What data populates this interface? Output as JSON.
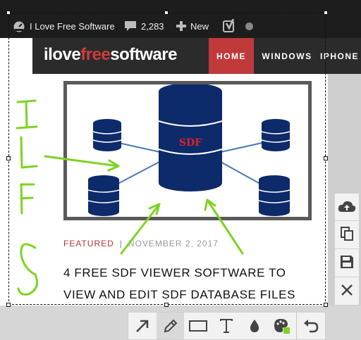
{
  "admin_bar": {
    "site_name": "I Love Free Software",
    "comments_count": "2,283",
    "new_label": "New"
  },
  "site_header": {
    "logo_part1": "ilove",
    "logo_part2": "free",
    "logo_part3": "software",
    "nav": [
      "HOME",
      "WINDOWS",
      "IPHONE"
    ]
  },
  "featured_image": {
    "label": "SDF"
  },
  "post": {
    "category": "FEATURED",
    "separator": "|",
    "date": "NOVEMBER 2, 2017",
    "title": "4 FREE SDF VIEWER SOFTWARE TO VIEW AND EDIT SDF DATABASE FILES"
  },
  "annotation": {
    "handwritten_letters": [
      "I",
      "L",
      "F",
      "S"
    ],
    "stroke_color": "#7ed321"
  },
  "side_toolbar": {
    "buttons": [
      "cloud-upload-icon",
      "copy-icon",
      "save-icon",
      "close-icon"
    ]
  },
  "bottom_toolbar": {
    "tools": [
      "arrow-icon",
      "pencil-icon",
      "rectangle-icon",
      "text-icon",
      "blur-icon",
      "color-palette-icon",
      "undo-icon"
    ],
    "active_tool": "pencil-icon",
    "color_swatch": "#7ed321"
  },
  "colors": {
    "admin_bar_bg": "#1d1d1d",
    "header_bg": "#2b2b2b",
    "home_nav_bg": "#c0393b",
    "db_blue": "#0d2a6b",
    "accent_red": "#b83232"
  }
}
